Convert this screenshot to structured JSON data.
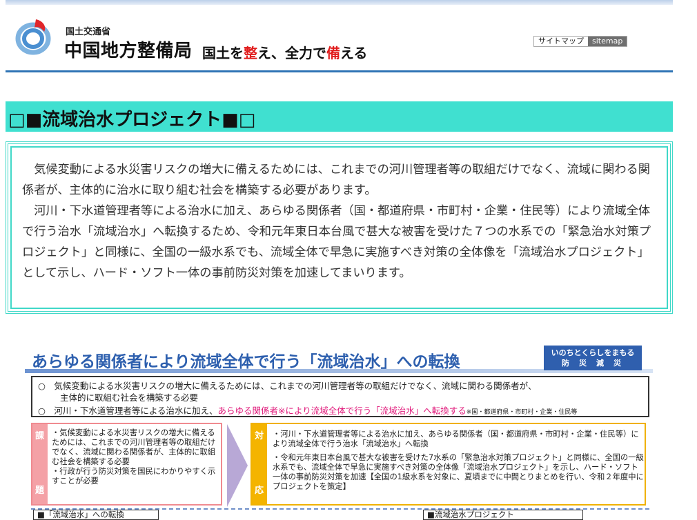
{
  "header": {
    "ministry": "国土交通省",
    "bureau": "中国地方整備局",
    "slogan_parts": [
      "国土を",
      "整",
      "え、全力で",
      "備",
      "える"
    ],
    "sitemap_jp": "サイトマップ",
    "sitemap_en": "sitemap",
    "logo_icon": "mlit-logo-icon"
  },
  "page": {
    "title": "□■流域治水プロジェクト■□",
    "intro_p1": "気候変動による水災害リスクの増大に備えるためには、これまでの河川管理者等の取組だけでなく、流域に関わる関係者が、主体的に治水に取り組む社会を構築する必要があります。",
    "intro_p2": "河川・下水道管理者等による治水に加え、あらゆる関係者（国・都道府県・市町村・企業・住民等）により流域全体で行う治水「流域治水」へ転換するため、令和元年東日本台風で甚大な被害を受けた７つの水系での「緊急治水対策プロジェクト」と同様に、全国の一級水系でも、流域全体で早急に実施すべき対策の全体像を「流域治水プロジェクト」として示し、ハード・ソフト一体の事前防災対策を加速してまいります。"
  },
  "diagram": {
    "title": "あらゆる関係者により流域全体で行う「流域治水」への転換",
    "badge_line1": "いのちとくらしをまもる",
    "badge_line2": "防災減災",
    "bullet1a": "○　気候変動による水災害リスクの増大に備えるためには、これまでの河川管理者等の取組だけでなく、流域に関わる関係者が、",
    "bullet1b": "主体的に取組む社会を構築する必要",
    "bullet2a": "○　河川・下水道管理者等による治水に加え、",
    "bullet2b": "あらゆる関係者※により流域全体で行う「流域治水」へ転換する",
    "bullet2c": "※国・都道府県・市町村・企業・住民等",
    "kadai_top": "課",
    "kadai_bottom": "題",
    "kadai_text": "・気候変動による水災害リスクの増大に備えるためには、これまでの河川管理者等の取組だけでなく、流域に関わる関係者が、主体的に取組む社会を構築する必要\n・行政が行う防災対策を国民にわかりやすく示すことが必要",
    "taiou_top": "対",
    "taiou_bottom": "応",
    "taiou_p1": "・河川・下水道管理者等による治水に加え、あらゆる関係者（国・都道府県・市町村・企業・住民等）により流域全体で行う治水「流域治水」へ転換",
    "taiou_p2": "・令和元年東日本台風で甚大な被害を受けた7水系の「緊急治水対策プロジェクト」と同様に、全国の一級水系でも、流域全体で早急に実施すべき対策の全体像「流域治水プロジェクト」を示し、ハード・ソフト一体の事前防災対策を加速【全国の1級水系を対象に、夏頃までに中間とりまとめを行い、令和２年度中にプロジェクトを策定】",
    "tag1": "■「流域治水」への転換",
    "tag2": "■流域治水プロジェクト"
  }
}
